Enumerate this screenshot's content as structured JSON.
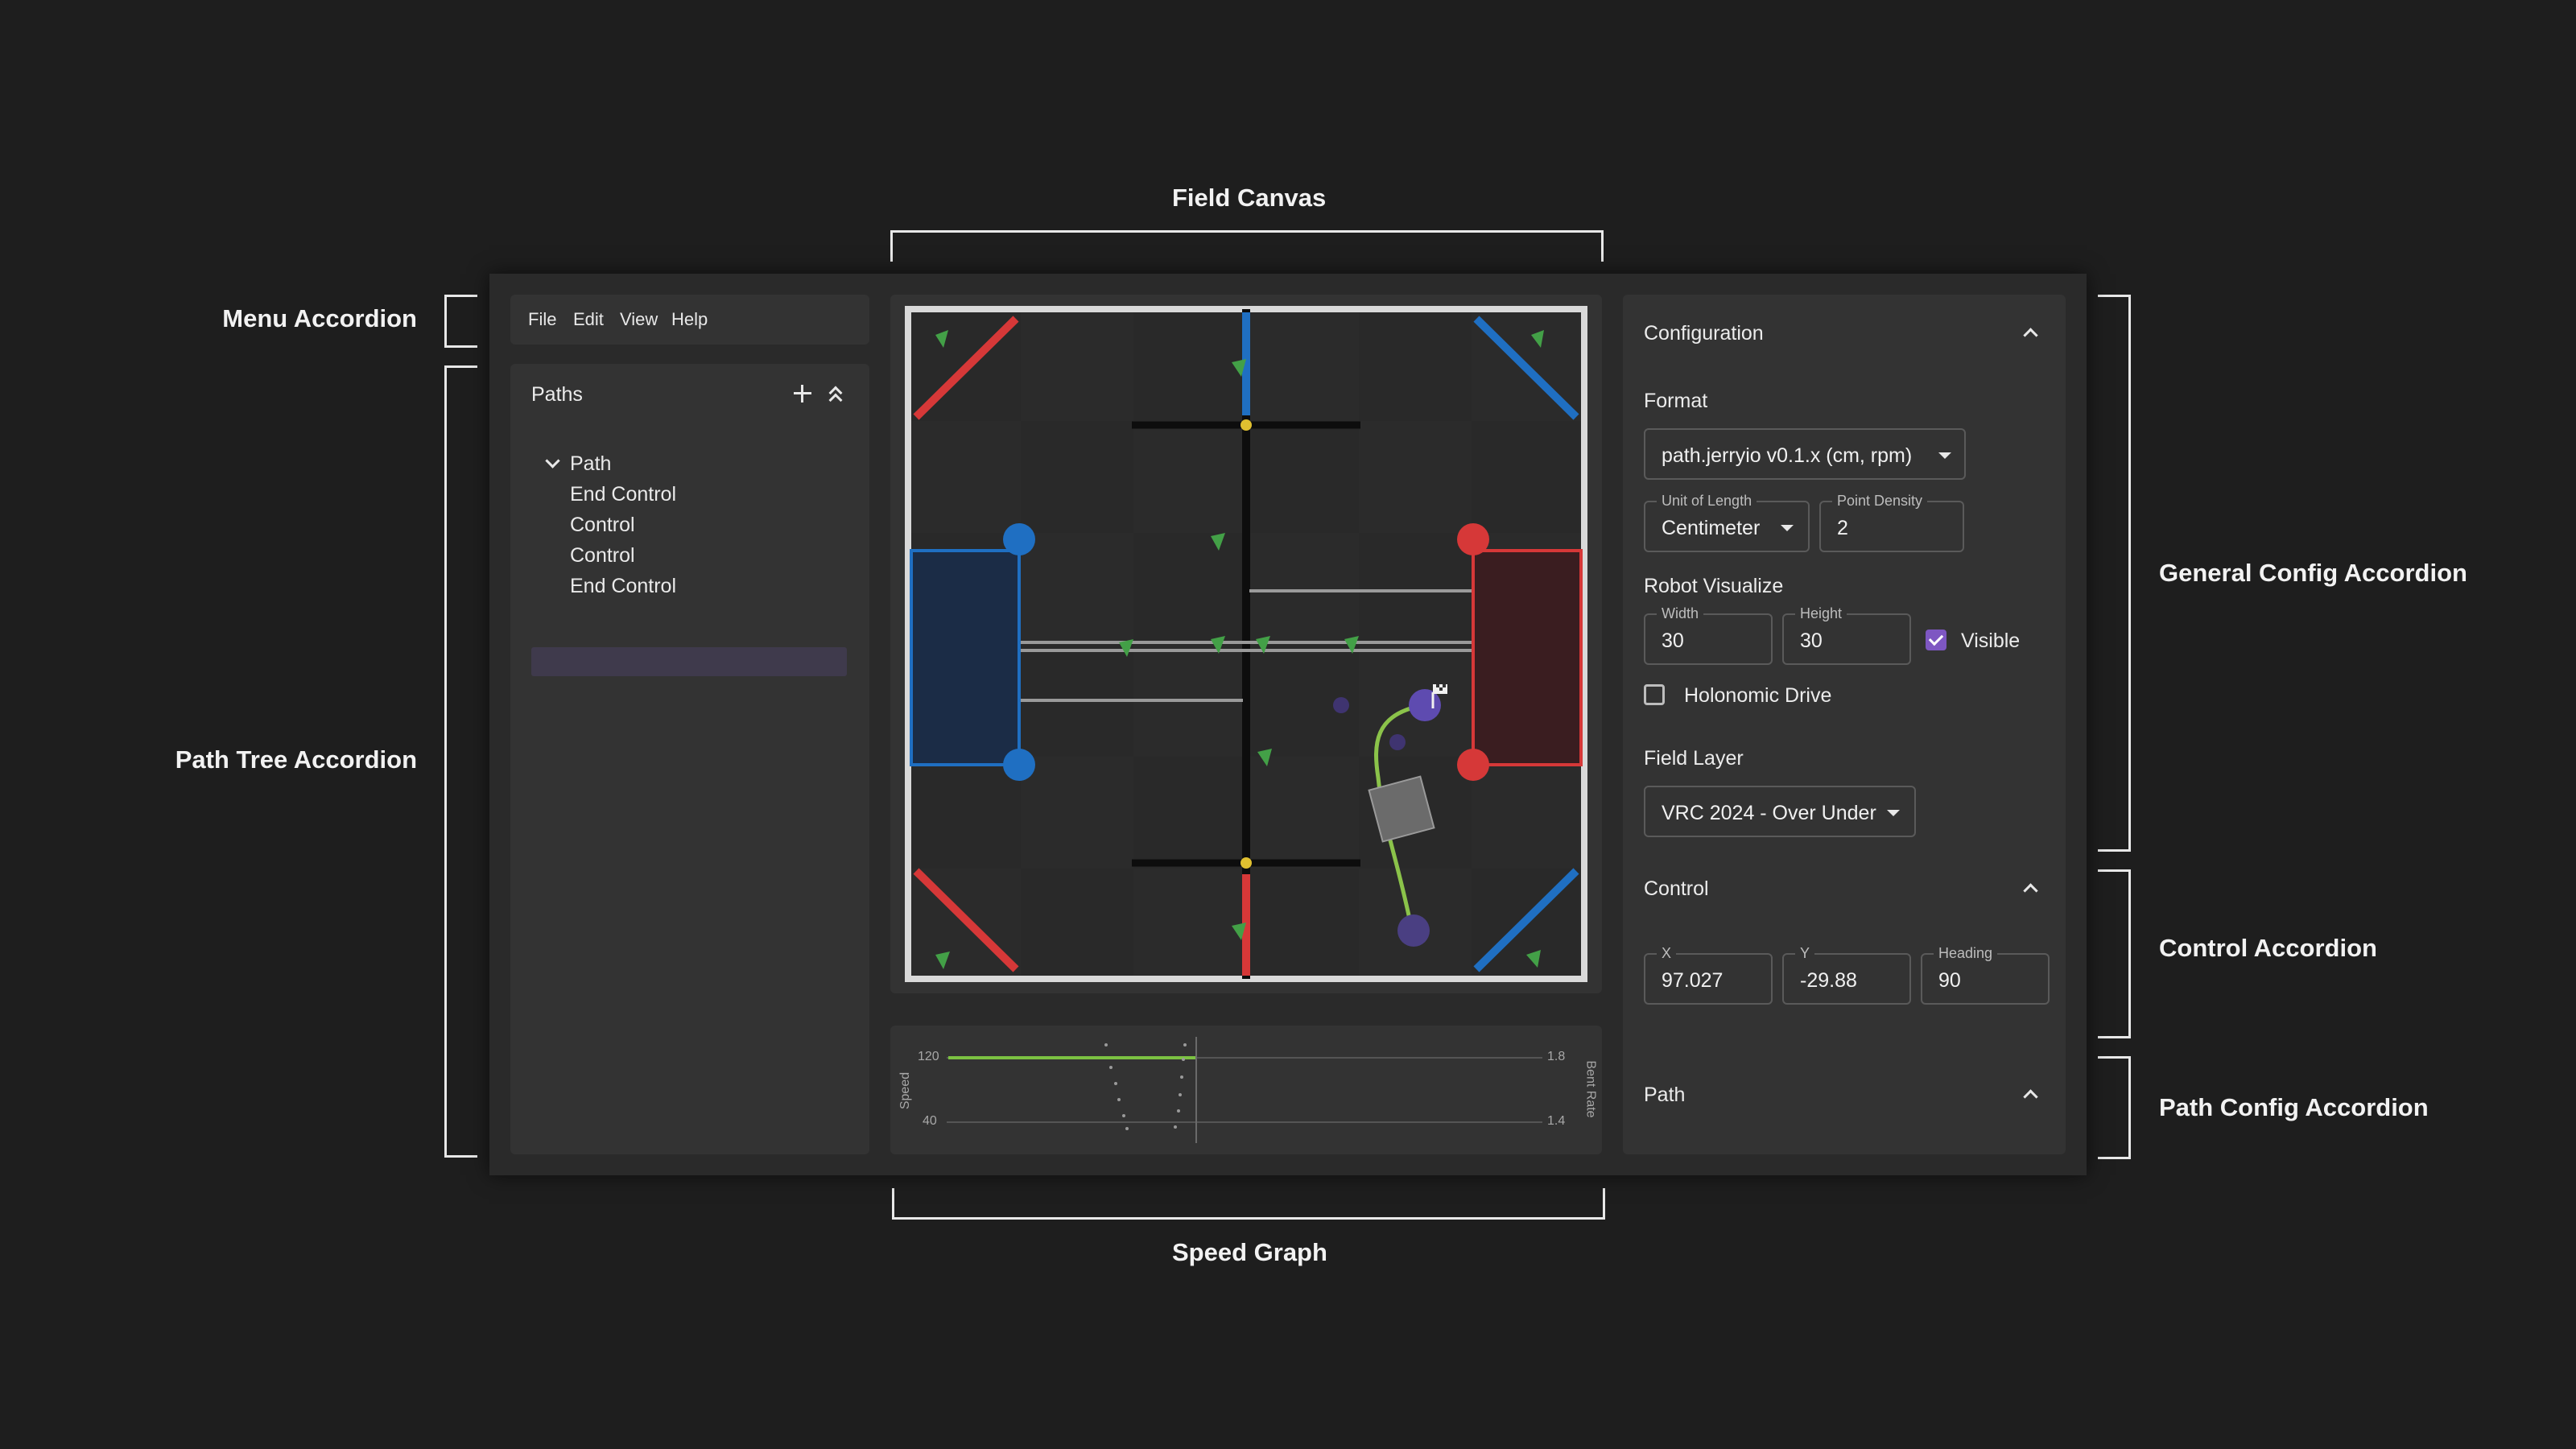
{
  "annotations": {
    "field_canvas": "Field Canvas",
    "menu_accordion": "Menu Accordion",
    "path_tree_accordion": "Path Tree Accordion",
    "general_config_accordion": "General Config Accordion",
    "control_accordion": "Control Accordion",
    "path_config_accordion": "Path Config Accordion",
    "speed_graph": "Speed Graph"
  },
  "menu": {
    "file": "File",
    "edit": "Edit",
    "view": "View",
    "help": "Help"
  },
  "paths": {
    "title": "Paths",
    "items": [
      {
        "label": "Path"
      },
      {
        "label": "End Control"
      },
      {
        "label": "Control"
      },
      {
        "label": "Control"
      },
      {
        "label": "End Control",
        "selected": true
      }
    ]
  },
  "config": {
    "title": "Configuration",
    "format_label": "Format",
    "format_value": "path.jerryio v0.1.x (cm, rpm)",
    "unit_legend": "Unit of Length",
    "unit_value": "Centimeter",
    "density_legend": "Point Density",
    "density_value": "2",
    "robot_label": "Robot Visualize",
    "width_legend": "Width",
    "width_value": "30",
    "height_legend": "Height",
    "height_value": "30",
    "visible_label": "Visible",
    "visible_checked": true,
    "holonomic_label": "Holonomic Drive",
    "holonomic_checked": false,
    "field_layer_label": "Field Layer",
    "field_layer_value": "VRC 2024 - Over Under"
  },
  "control": {
    "title": "Control",
    "x_legend": "X",
    "x_value": "97.027",
    "y_legend": "Y",
    "y_value": "-29.88",
    "heading_legend": "Heading",
    "heading_value": "90"
  },
  "path_config": {
    "title": "Path"
  },
  "speed_graph": {
    "left_axis_label": "Speed",
    "right_axis_label": "Bent Rate",
    "left_ticks": [
      "120",
      "40"
    ],
    "right_ticks": [
      "1.8",
      "1.4"
    ]
  },
  "colors": {
    "accent": "#7e57c2",
    "path": "#8bc34a",
    "red": "#e53935",
    "blue": "#1e88e5"
  }
}
